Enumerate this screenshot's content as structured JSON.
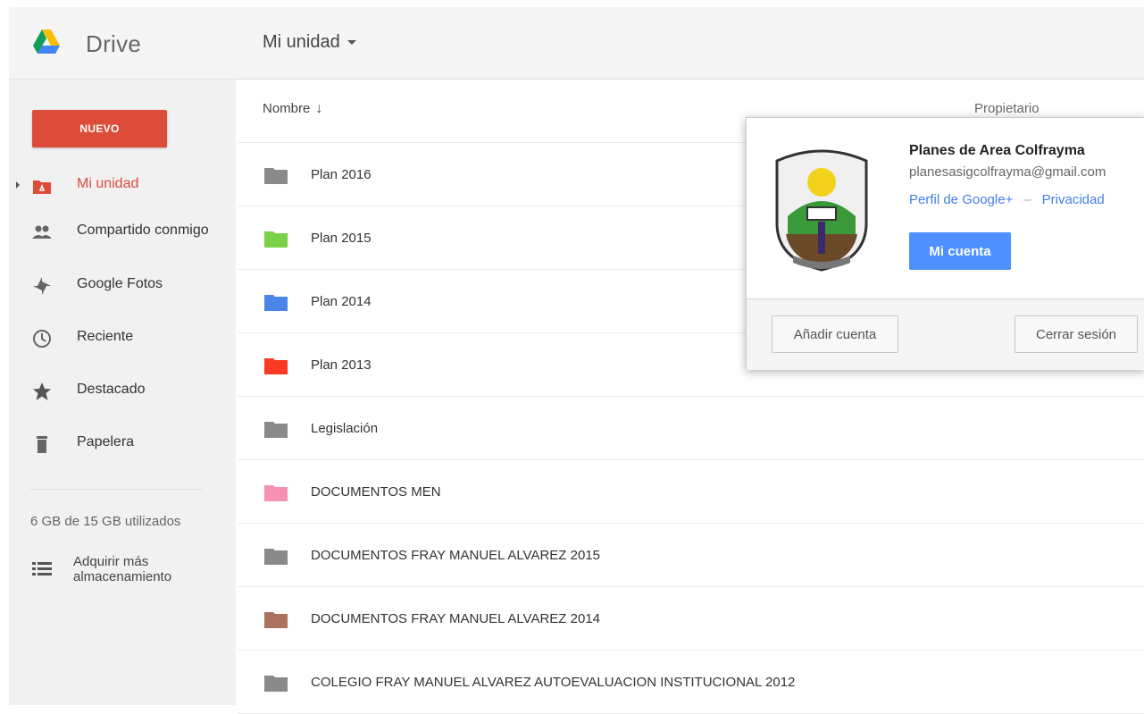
{
  "header": {
    "brand": "Drive",
    "breadcrumb": "Mi unidad"
  },
  "sidebar": {
    "new_label": "NUEVO",
    "items": [
      {
        "label": "Mi unidad",
        "icon": "my-drive-icon",
        "active": true
      },
      {
        "label": "Compartido conmigo",
        "icon": "people-icon"
      },
      {
        "label": "Google Fotos",
        "icon": "pinwheel-icon"
      },
      {
        "label": "Reciente",
        "icon": "clock-icon"
      },
      {
        "label": "Destacado",
        "icon": "star-icon"
      },
      {
        "label": "Papelera",
        "icon": "trash-icon"
      }
    ],
    "storage": "6 GB de 15 GB utilizados",
    "buy_storage": "Adquirir más almacenamiento"
  },
  "main": {
    "col_name": "Nombre",
    "col_owner": "Propietario",
    "rows": [
      {
        "name": "Plan 2016",
        "color": "#8a8a8a"
      },
      {
        "name": "Plan 2015",
        "color": "#7bd148"
      },
      {
        "name": "Plan 2014",
        "color": "#4a86e8"
      },
      {
        "name": "Plan 2013",
        "color": "#f83a22"
      },
      {
        "name": "Legislación",
        "color": "#8a8a8a"
      },
      {
        "name": "DOCUMENTOS MEN",
        "color": "#f691b2"
      },
      {
        "name": "DOCUMENTOS FRAY MANUEL ALVAREZ 2015",
        "color": "#8a8a8a"
      },
      {
        "name": "DOCUMENTOS FRAY MANUEL ALVAREZ 2014",
        "color": "#ac725e"
      },
      {
        "name": "COLEGIO FRAY MANUEL ALVAREZ AUTOEVALUACION INSTITUCIONAL 2012",
        "color": "#8a8a8a"
      }
    ]
  },
  "account": {
    "name": "Planes de Area Colfrayma",
    "email": "planesasigcolfrayma@gmail.com",
    "profile_link": "Perfil de Google+",
    "separator": "–",
    "privacy_link": "Privacidad",
    "my_account": "Mi cuenta",
    "add_account": "Añadir cuenta",
    "sign_out": "Cerrar sesión",
    "avatar_icon": "school-crest-icon"
  },
  "colors": {
    "new_button": "#dd4b39",
    "active_nav": "#dd4b39",
    "link": "#427fed",
    "primary_button": "#4d90fe"
  }
}
